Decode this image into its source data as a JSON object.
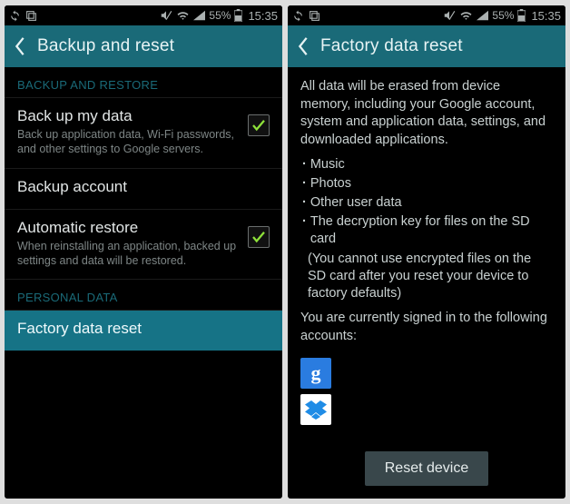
{
  "status": {
    "battery_pct": "55%",
    "time": "15:35"
  },
  "left": {
    "title": "Backup and reset",
    "section_backup": "BACKUP AND RESTORE",
    "backup_my_data": {
      "title": "Back up my data",
      "sub": "Back up application data, Wi-Fi passwords, and other settings to Google servers."
    },
    "backup_account": {
      "title": "Backup account"
    },
    "auto_restore": {
      "title": "Automatic restore",
      "sub": "When reinstalling an application, backed up settings and data will be restored."
    },
    "section_personal": "PERSONAL DATA",
    "factory_reset": {
      "title": "Factory data reset"
    }
  },
  "right": {
    "title": "Factory data reset",
    "intro": "All data will be erased from device memory, including your Google account, system and application data, settings, and downloaded applications.",
    "bullets": [
      "Music",
      "Photos",
      "Other user data",
      "The decryption key for files on the SD card"
    ],
    "paren": "(You cannot use encrypted files on the SD card after you reset your device to factory defaults)",
    "signed_in": "You are currently signed in to the following accounts:",
    "reset_btn": "Reset device"
  }
}
